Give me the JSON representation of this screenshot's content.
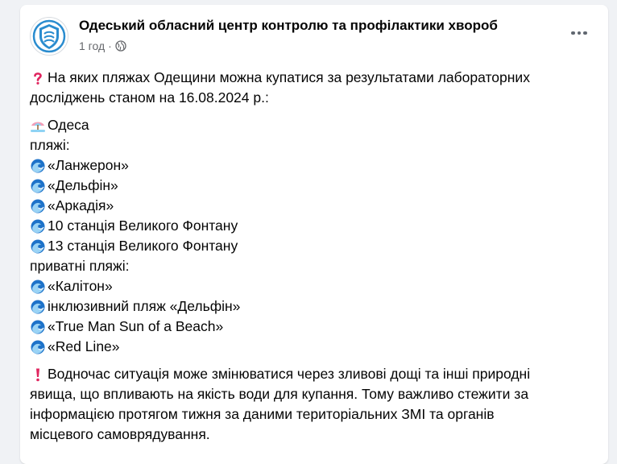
{
  "post": {
    "author": "Одеський обласний центр контролю та профілактики хвороб",
    "time": "1 год",
    "intro_line1": "На яких пляжах Одещини можна купатися за результатами лабораторних",
    "intro_line2": "досліджень станом на 16.08.2024 р.:",
    "city": "Одеса",
    "beaches_label": "пляжі:",
    "beaches": [
      "«Ланжерон»",
      "«Дельфін»",
      "«Аркадія»",
      "10 станція Великого Фонтану",
      "13 станція Великого Фонтану"
    ],
    "private_label": "приватні пляжі:",
    "private_beaches": [
      "«Калітон»",
      "інклюзивний пляж «Дельфін»",
      "«True Man Sun of a Beach»",
      "«Red Line»"
    ],
    "warning_line1": "Водночас ситуація може змінюватися через зливові дощі та інші природні",
    "warning_line2": "явища, що впливають на якість води для купання. Тому важливо стежити за",
    "warning_line3": "інформацією протягом тижня за даними територіальних ЗМІ та органів",
    "warning_line4": "місцевого самоврядування."
  },
  "icons": {
    "question": "red-question-mark-icon",
    "beach": "beach-umbrella-icon",
    "wave": "water-wave-icon",
    "exclamation": "red-exclamation-mark-icon",
    "globe": "globe-icon",
    "more": "more-options-icon"
  },
  "colors": {
    "accent_red": "#e0245e",
    "wave_blue": "#1d72c9",
    "text": "#050505",
    "muted": "#65676b"
  }
}
